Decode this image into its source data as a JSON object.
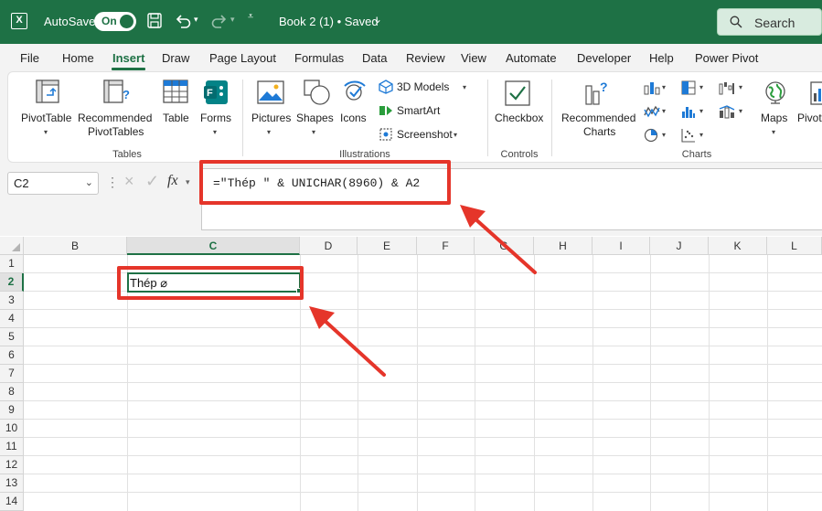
{
  "titlebar": {
    "autosave_label": "AutoSave",
    "autosave_state": "On",
    "document_title": "Book 2 (1) • Saved",
    "search_label": "Search"
  },
  "tabs": [
    {
      "label": "File"
    },
    {
      "label": "Home"
    },
    {
      "label": "Insert",
      "active": true
    },
    {
      "label": "Draw"
    },
    {
      "label": "Page Layout"
    },
    {
      "label": "Formulas"
    },
    {
      "label": "Data"
    },
    {
      "label": "Review"
    },
    {
      "label": "View"
    },
    {
      "label": "Automate"
    },
    {
      "label": "Developer"
    },
    {
      "label": "Help"
    },
    {
      "label": "Power Pivot"
    }
  ],
  "ribbon": {
    "tables": {
      "group_label": "Tables",
      "pivottable": "PivotTable",
      "recommended_pivottables_1": "Recommended",
      "recommended_pivottables_2": "PivotTables",
      "table": "Table",
      "forms": "Forms"
    },
    "illustrations": {
      "group_label": "Illustrations",
      "pictures": "Pictures",
      "shapes": "Shapes",
      "icons": "Icons",
      "models_3d": "3D Models",
      "smartart": "SmartArt",
      "screenshot": "Screenshot"
    },
    "controls": {
      "group_label": "Controls",
      "checkbox": "Checkbox"
    },
    "charts": {
      "group_label": "Charts",
      "recommended_charts_1": "Recommended",
      "recommended_charts_2": "Charts",
      "maps": "Maps",
      "pivot_chart_partial": "Pivot"
    }
  },
  "formula_bar": {
    "name_box": "C2",
    "fx": "fx",
    "formula": "=\"Thép \" & UNICHAR(8960) & A2"
  },
  "grid": {
    "columns": [
      "B",
      "C",
      "D",
      "E",
      "F",
      "G",
      "H",
      "I",
      "J",
      "K",
      "L"
    ],
    "rows": [
      "1",
      "2",
      "3",
      "4",
      "5",
      "6",
      "7",
      "8",
      "9",
      "10",
      "11",
      "12",
      "13",
      "14"
    ],
    "selected_column": "C",
    "selected_row": "2",
    "cell_c2": "Thép ⌀"
  },
  "colors": {
    "excel_green": "#1e7145",
    "annotation_red": "#e5352a"
  }
}
